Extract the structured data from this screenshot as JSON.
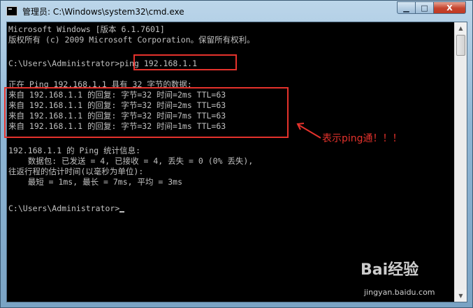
{
  "window": {
    "title": "管理员: C:\\Windows\\system32\\cmd.exe",
    "controls": {
      "minimize": "▁",
      "maximize": "□",
      "close": "X"
    }
  },
  "console": {
    "lines": [
      "Microsoft Windows [版本 6.1.7601]",
      "版权所有 (c) 2009 Microsoft Corporation。保留所有权利。",
      "",
      "C:\\Users\\Administrator>ping 192.168.1.1",
      "",
      "正在 Ping 192.168.1.1 具有 32 字节的数据:",
      "来自 192.168.1.1 的回复: 字节=32 时间=2ms TTL=63",
      "来自 192.168.1.1 的回复: 字节=32 时间=2ms TTL=63",
      "来自 192.168.1.1 的回复: 字节=32 时间=7ms TTL=63",
      "来自 192.168.1.1 的回复: 字节=32 时间=1ms TTL=63",
      "",
      "192.168.1.1 的 Ping 统计信息:",
      "    数据包: 已发送 = 4, 已接收 = 4, 丢失 = 0 (0% 丢失),",
      "往返行程的估计时间(以毫秒为单位):",
      "    最短 = 1ms, 最长 = 7ms, 平均 = 3ms",
      "",
      "",
      "C:\\Users\\Administrator>"
    ]
  },
  "scrollbar": {
    "up": "▲",
    "down": "▼"
  },
  "annotation": {
    "text": "表示ping通！！！",
    "color": "#e5322c"
  },
  "watermark": {
    "logo": "Bai经验",
    "url": "jingyan.baidu.com"
  },
  "colors": {
    "console_bg": "#000000",
    "console_fg": "#c0c0c0",
    "highlight": "#e5322c"
  }
}
